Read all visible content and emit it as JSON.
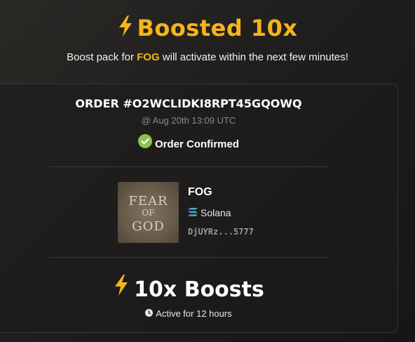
{
  "header": {
    "title": "Boosted 10x",
    "subtitle_prefix": "Boost pack for",
    "subtitle_token": "FOG",
    "subtitle_suffix": "will activate within the next few minutes!",
    "title_icon": "lightning-bolt-icon"
  },
  "order": {
    "id": "ORDER #O2WCLIDKI8RPT45GQOWQ",
    "date": "@ Aug 20th 13:09 UTC",
    "status": "Order Confirmed",
    "status_icon": "check-circle-icon"
  },
  "token": {
    "name": "FOG",
    "chain": "Solana",
    "chain_icon": "solana-icon",
    "address": "DjUYRz...5777",
    "image_text": [
      "FEAR",
      "OF",
      "GOD"
    ]
  },
  "boost": {
    "label": "10x Boosts",
    "duration": "Active for 12 hours",
    "icon": "lightning-bolt-icon",
    "duration_icon": "clock-icon"
  },
  "colors": {
    "accent": "#f5b41a",
    "success": "#8bc34a",
    "muted": "#8c8a87"
  }
}
